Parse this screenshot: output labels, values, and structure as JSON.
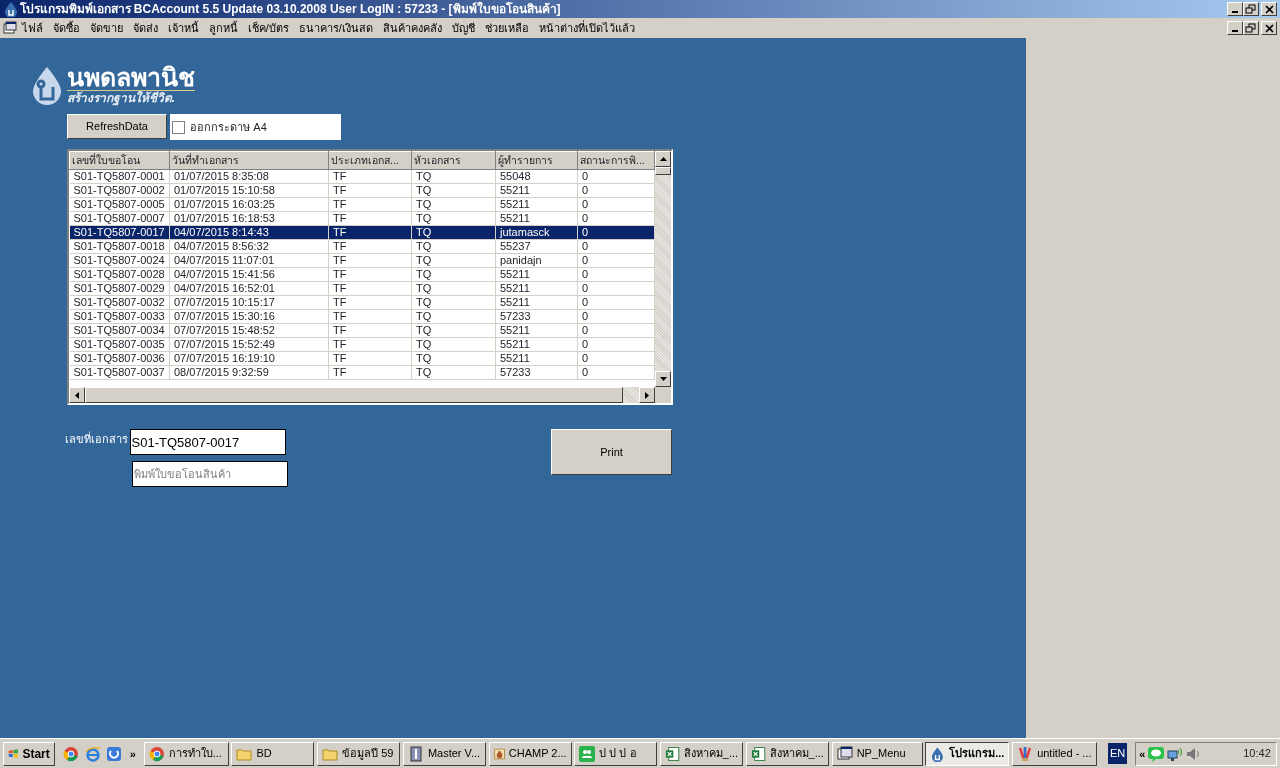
{
  "window": {
    "title": "โปรแกรมพิมพ์เอกสาร BCAccount 5.5 Update 03.10.2008 User LogIN : 57233 - [พิมพ์ใบขอโอนสินค้า]"
  },
  "menu": [
    "ไฟล์",
    "จัดซื้อ",
    "จัดขาย",
    "จัดส่ง",
    "เจ้าหนี้",
    "ลูกหนี้",
    "เช็ค/บัตร",
    "ธนาคาร/เงินสด",
    "สินค้าคงคลัง",
    "บัญชี",
    "ช่วยเหลือ",
    "หน้าต่างที่เปิดไว้แล้ว"
  ],
  "logo": {
    "name": "นพดลพานิช",
    "slogan": "สร้างรากฐานให้ชีวิต."
  },
  "refresh_button": "RefreshData",
  "print_option": {
    "label": "ออกกระดาษ A4",
    "checked": false
  },
  "table": {
    "columns": [
      "เลขที่ใบขอโอน",
      "วันที่ทำเอกสาร",
      "ประเภทเอกส...",
      "หัวเอกสาร",
      "ผู้ทำรายการ",
      "สถานะการพิ..."
    ],
    "rows": [
      {
        "cells": [
          "S01-TQ5807-0001",
          "01/07/2015 8:35:08",
          "TF",
          "TQ",
          "55048",
          "0"
        ],
        "selected": false
      },
      {
        "cells": [
          "S01-TQ5807-0002",
          "01/07/2015 15:10:58",
          "TF",
          "TQ",
          "55211",
          "0"
        ],
        "selected": false
      },
      {
        "cells": [
          "S01-TQ5807-0005",
          "01/07/2015 16:03:25",
          "TF",
          "TQ",
          "55211",
          "0"
        ],
        "selected": false
      },
      {
        "cells": [
          "S01-TQ5807-0007",
          "01/07/2015 16:18:53",
          "TF",
          "TQ",
          "55211",
          "0"
        ],
        "selected": false
      },
      {
        "cells": [
          "S01-TQ5807-0017",
          "04/07/2015 8:14:43",
          "TF",
          "TQ",
          "jutamasck",
          "0"
        ],
        "selected": true
      },
      {
        "cells": [
          "S01-TQ5807-0018",
          "04/07/2015 8:56:32",
          "TF",
          "TQ",
          "55237",
          "0"
        ],
        "selected": false
      },
      {
        "cells": [
          "S01-TQ5807-0024",
          "04/07/2015 11:07:01",
          "TF",
          "TQ",
          "panidajn",
          "0"
        ],
        "selected": false
      },
      {
        "cells": [
          "S01-TQ5807-0028",
          "04/07/2015 15:41:56",
          "TF",
          "TQ",
          "55211",
          "0"
        ],
        "selected": false
      },
      {
        "cells": [
          "S01-TQ5807-0029",
          "04/07/2015 16:52:01",
          "TF",
          "TQ",
          "55211",
          "0"
        ],
        "selected": false
      },
      {
        "cells": [
          "S01-TQ5807-0032",
          "07/07/2015 10:15:17",
          "TF",
          "TQ",
          "55211",
          "0"
        ],
        "selected": false
      },
      {
        "cells": [
          "S01-TQ5807-0033",
          "07/07/2015 15:30:16",
          "TF",
          "TQ",
          "57233",
          "0"
        ],
        "selected": false
      },
      {
        "cells": [
          "S01-TQ5807-0034",
          "07/07/2015 15:48:52",
          "TF",
          "TQ",
          "55211",
          "0"
        ],
        "selected": false
      },
      {
        "cells": [
          "S01-TQ5807-0035",
          "07/07/2015 15:52:49",
          "TF",
          "TQ",
          "55211",
          "0"
        ],
        "selected": false
      },
      {
        "cells": [
          "S01-TQ5807-0036",
          "07/07/2015 16:19:10",
          "TF",
          "TQ",
          "55211",
          "0"
        ],
        "selected": false
      },
      {
        "cells": [
          "S01-TQ5807-0037",
          "08/07/2015 9:32:59",
          "TF",
          "TQ",
          "57233",
          "0"
        ],
        "selected": false
      }
    ]
  },
  "document_field": {
    "label": "เลขที่เอกสาร",
    "value": "S01-TQ5807-0017"
  },
  "title_field": {
    "placeholder": "พิมพ์ใบขอโอนสินค้า"
  },
  "print_button": "Print",
  "taskbar": {
    "start": "Start",
    "more": "»",
    "tasks": [
      {
        "kind": "chrome",
        "label": "การทำใบ...",
        "selected": false
      },
      {
        "kind": "folder",
        "label": "BD",
        "selected": false
      },
      {
        "kind": "folder",
        "label": "ข้อมูลปี 59",
        "selected": false
      },
      {
        "kind": "book",
        "label": "Master V...",
        "selected": false
      },
      {
        "kind": "vase",
        "label": "CHAMP 2...",
        "selected": false
      },
      {
        "kind": "people",
        "label": "ป ป ป อ",
        "selected": false
      },
      {
        "kind": "excel",
        "label": "สิงหาคม_...",
        "selected": false
      },
      {
        "kind": "excel",
        "label": "สิงหาคม_...",
        "selected": false
      },
      {
        "kind": "window",
        "label": "NP_Menu",
        "selected": false
      },
      {
        "kind": "drop",
        "label": "โปรแกรม...",
        "selected": true
      },
      {
        "kind": "paint",
        "label": "untitled - ...",
        "selected": false
      }
    ],
    "language": "EN",
    "tray_expand": "«",
    "clock": "10:42"
  }
}
